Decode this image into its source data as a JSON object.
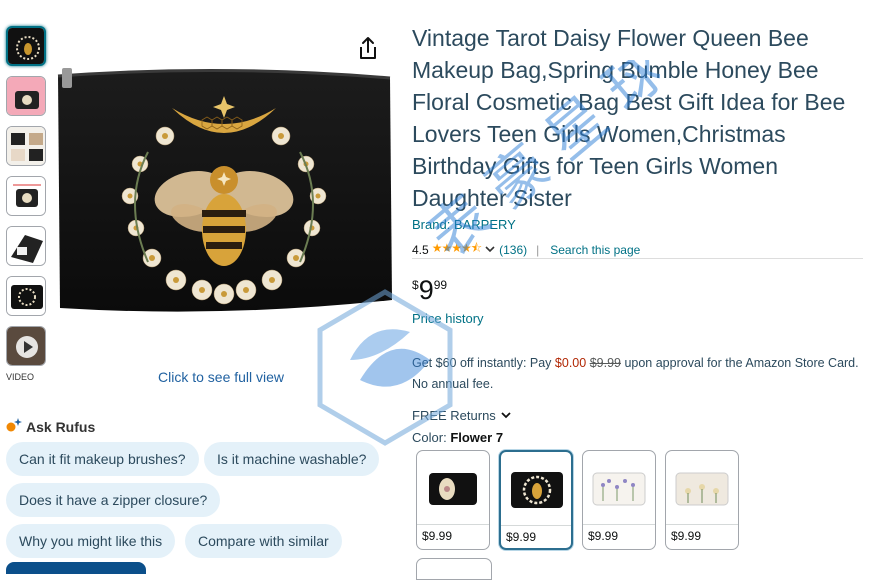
{
  "thumbnails": [
    {
      "name": "thumb-bee-black"
    },
    {
      "name": "thumb-pink"
    },
    {
      "name": "thumb-collage"
    },
    {
      "name": "thumb-dimensions"
    },
    {
      "name": "thumb-lifestyle"
    },
    {
      "name": "thumb-bee-close"
    },
    {
      "name": "thumb-video"
    }
  ],
  "video_label": "VIDEO",
  "click_full_view": "Click to see full view",
  "rufus": {
    "title": "Ask Rufus",
    "chips": [
      "Can it fit makeup brushes?",
      "Is it machine washable?",
      "Does it have a zipper closure?",
      "Why you might like this",
      "Compare with similar"
    ]
  },
  "product": {
    "title": "Vintage Tarot Daisy Flower Queen Bee Makeup Bag,Spring Bumble Honey Bee Floral Cosmetic Bag Best Gift Idea for Bee Lovers Teen Girls Women,Christmas Birthday Gifts for Teen Girls Women Daughter Sister",
    "brand": "Brand: BARPERY",
    "rating": "4.5",
    "stars": "★★★★⯪",
    "rating_count": "(136)",
    "search_page": "Search this page",
    "price_symbol": "$",
    "price_whole": "9",
    "price_fraction": "99",
    "price_history": "Price history",
    "offer": {
      "prefix": "Get $60 off instantly: Pay ",
      "pay": "$0.00",
      "was": "$9.99",
      "suffix": " upon approval for the Amazon Store Card. No annual fee."
    },
    "returns": "FREE Returns",
    "color_label": "Color:",
    "color_value": "Flower 7",
    "swatches": [
      {
        "price": "$9.99"
      },
      {
        "price": "$9.99"
      },
      {
        "price": "$9.99"
      },
      {
        "price": "$9.99"
      }
    ]
  },
  "icons": {
    "share": "share-icon",
    "chevron": "chevron-down-icon",
    "sparkle": "sparkle-icon",
    "play": "play-icon"
  },
  "watermark_text": "表 豪 星 球",
  "colors": {
    "link": "#007185",
    "title": "#2c4a5d",
    "chip_bg": "#e4f1f9",
    "star": "#ff9a00",
    "deal_red": "#B12704",
    "watermark": "#2e7fd6"
  }
}
